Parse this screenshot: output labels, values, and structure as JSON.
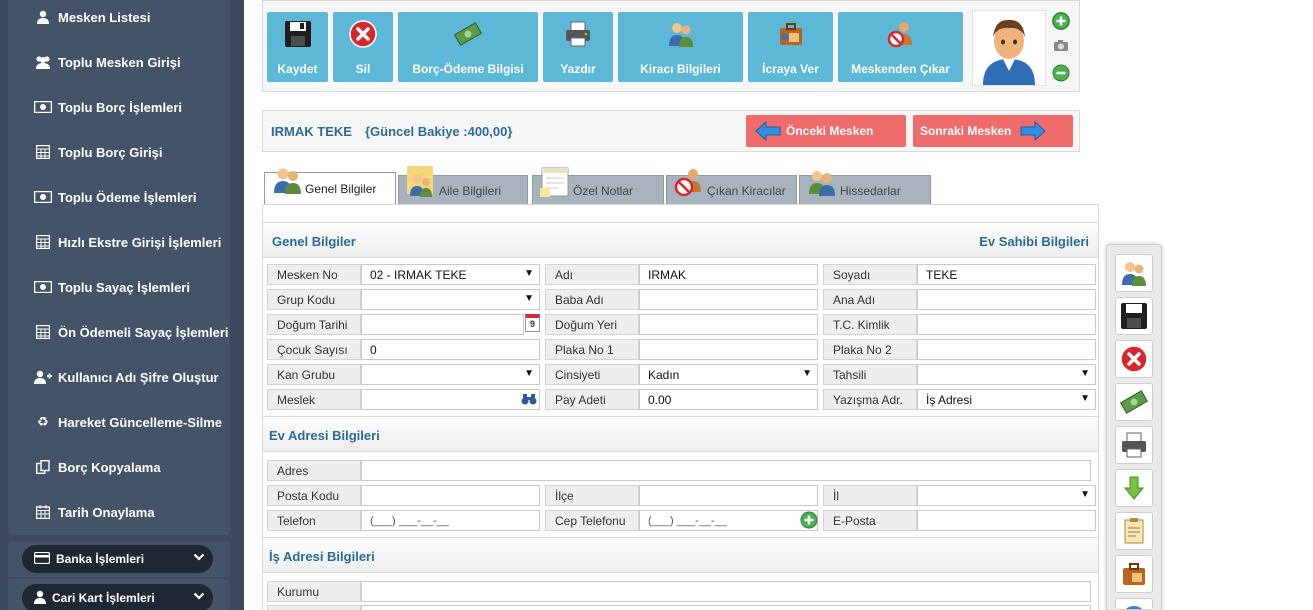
{
  "sidebar": {
    "items": [
      {
        "label": "Mesken Listesi",
        "icon": "user-icon"
      },
      {
        "label": "Toplu Mesken Girişi",
        "icon": "users-icon"
      },
      {
        "label": "Toplu Borç İşlemleri",
        "icon": "money-icon"
      },
      {
        "label": "Toplu Borç Girişi",
        "icon": "calculator-icon"
      },
      {
        "label": "Toplu Ödeme İşlemleri",
        "icon": "money-icon"
      },
      {
        "label": "Hızlı Ekstre Girişi İşlemleri",
        "icon": "calculator-icon"
      },
      {
        "label": "Toplu Sayaç İşlemleri",
        "icon": "money-icon"
      },
      {
        "label": "Ön Ödemeli Sayaç İşlemleri",
        "icon": "calculator-icon"
      },
      {
        "label": "Kullanıcı Adı Şifre Oluştur",
        "icon": "user-plus-icon"
      },
      {
        "label": "Hareket Güncelleme-Silme",
        "icon": "recycle-icon"
      },
      {
        "label": "Borç Kopyalama",
        "icon": "copy-icon"
      },
      {
        "label": "Tarih Onaylama",
        "icon": "calendar-icon"
      }
    ],
    "groups": [
      {
        "label": "Banka İşlemleri",
        "icon": "credit-card-icon"
      },
      {
        "label": "Cari Kart İşlemleri",
        "icon": "user-icon"
      }
    ]
  },
  "toolbar": {
    "buttons": [
      {
        "label": "Kaydet",
        "icon": "save-icon"
      },
      {
        "label": "Sil",
        "icon": "delete-icon"
      },
      {
        "label": "Borç-Ödeme Bilgisi",
        "icon": "money-icon"
      },
      {
        "label": "Yazdır",
        "icon": "printer-icon"
      },
      {
        "label": "Kiracı Bilgileri",
        "icon": "tenants-icon"
      },
      {
        "label": "İcraya Ver",
        "icon": "briefcase-icon"
      },
      {
        "label": "Meskenden Çıkar",
        "icon": "remove-user-icon"
      }
    ]
  },
  "header": {
    "name": "IRMAK TEKE",
    "balance": "{Güncel Bakiye :400,00}",
    "prev_label": "Önceki Mesken",
    "next_label": "Sonraki Mesken"
  },
  "tabs": [
    {
      "label": "Genel Bilgiler",
      "icon": "users-icon"
    },
    {
      "label": "Aile Bilgileri",
      "icon": "family-icon"
    },
    {
      "label": "Özel Notlar",
      "icon": "notes-icon"
    },
    {
      "label": "Çıkan Kiracılar",
      "icon": "departed-icon"
    },
    {
      "label": "Hissedarlar",
      "icon": "shareholders-icon"
    }
  ],
  "sections": {
    "general": "Genel Bilgiler",
    "owner": "Ev Sahibi Bilgileri",
    "home_address": "Ev Adresi Bilgileri",
    "work_address": "İş Adresi Bilgileri"
  },
  "fields": {
    "mesken_no": {
      "label": "Mesken No",
      "value": "02 - IRMAK TEKE"
    },
    "adi": {
      "label": "Adı",
      "value": "IRMAK"
    },
    "soyadi": {
      "label": "Soyadı",
      "value": "TEKE"
    },
    "grup_kodu": {
      "label": "Grup Kodu",
      "value": ""
    },
    "baba_adi": {
      "label": "Baba Adı",
      "value": ""
    },
    "ana_adi": {
      "label": "Ana Adı",
      "value": ""
    },
    "dogum_tarihi": {
      "label": "Doğum Tarihi",
      "value": ""
    },
    "dogum_yeri": {
      "label": "Doğum Yeri",
      "value": ""
    },
    "tc_kimlik": {
      "label": "T.C. Kimlik",
      "value": ""
    },
    "cocuk_sayisi": {
      "label": "Çocuk Sayısı",
      "value": "0"
    },
    "plaka_1": {
      "label": "Plaka No 1",
      "value": ""
    },
    "plaka_2": {
      "label": "Plaka No 2",
      "value": ""
    },
    "kan_grubu": {
      "label": "Kan Grubu",
      "value": ""
    },
    "cinsiyeti": {
      "label": "Cinsiyeti",
      "value": "Kadın"
    },
    "tahsili": {
      "label": "Tahsili",
      "value": ""
    },
    "meslek": {
      "label": "Meslek",
      "value": ""
    },
    "pay_adeti": {
      "label": "Pay Adeti",
      "value": "0.00"
    },
    "yazisma": {
      "label": "Yazışma Adr.",
      "value": "İş Adresi"
    },
    "adres": {
      "label": "Adres",
      "value": ""
    },
    "posta_kodu": {
      "label": "Posta Kodu",
      "value": ""
    },
    "ilce": {
      "label": "İlçe",
      "value": ""
    },
    "il": {
      "label": "İl",
      "value": ""
    },
    "telefon": {
      "label": "Telefon",
      "value": "(___) ___-__-__"
    },
    "cep_telefonu": {
      "label": "Cep Telefonu",
      "value": "(___) ___-__-__"
    },
    "eposta": {
      "label": "E-Posta",
      "value": ""
    },
    "kurumu": {
      "label": "Kurumu",
      "value": ""
    }
  },
  "calendar_day": "9",
  "right_tools": [
    "users-icon",
    "save-icon",
    "delete-icon",
    "money-icon",
    "printer-icon",
    "download-icon",
    "document-icon",
    "briefcase-icon",
    "globe-icon"
  ],
  "colors": {
    "sidebar_bg": "#3d4a5e",
    "toolbar_btn": "#5cb8d6",
    "nav_btn": "#f06b6b",
    "heading": "#2c6a9b"
  }
}
